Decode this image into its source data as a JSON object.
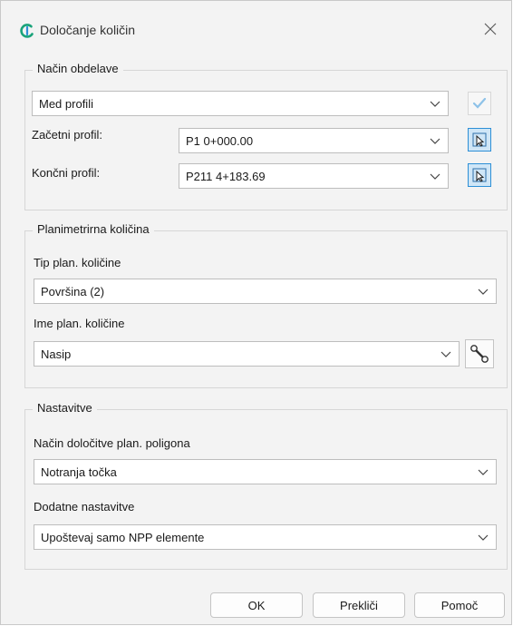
{
  "window": {
    "title": "Določanje količin",
    "close_icon": "close-icon"
  },
  "colors": {
    "accent": "#2d8fd6",
    "logo": "#1aa37a",
    "selected_icon_bg": "#cfe6f7"
  },
  "section_method": {
    "legend": "Način obdelave",
    "mode_value": "Med profili",
    "start_label": "Začetni profil:",
    "start_value": "P1 0+000.00",
    "end_label": "Končni profil:",
    "end_value": "P211 4+183.69"
  },
  "section_planimetric": {
    "legend": "Planimetrirna količina",
    "type_label": "Tip plan. količine",
    "type_value": "Površina (2)",
    "name_label": "Ime plan. količine",
    "name_value": "Nasip"
  },
  "section_settings": {
    "legend": "Nastavitve",
    "method_label": "Način določitve plan. poligona",
    "method_value": "Notranja točka",
    "extra_label": "Dodatne nastavitve",
    "extra_value": "Upoštevaj samo NPP elemente"
  },
  "buttons": {
    "ok": "OK",
    "cancel": "Prekliči",
    "help": "Pomoč"
  }
}
